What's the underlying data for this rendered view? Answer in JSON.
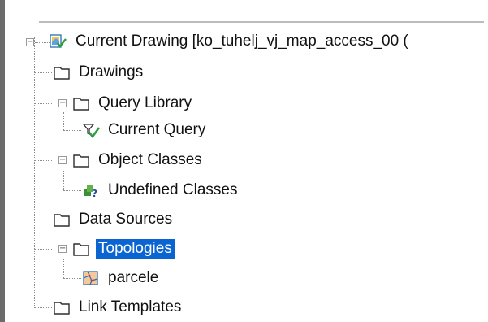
{
  "tree": {
    "root": {
      "label": "Current Drawing [ko_tuhelj_vj_map_access_00 (",
      "icon": "drawing-map-icon",
      "expanded": true
    },
    "items": [
      {
        "label": "Drawings",
        "icon": "folder-icon"
      },
      {
        "label": "Query Library",
        "icon": "folder-icon",
        "expanded": true
      },
      {
        "label": "Current Query",
        "icon": "query-filter-check-icon"
      },
      {
        "label": "Object Classes",
        "icon": "folder-icon",
        "expanded": true
      },
      {
        "label": "Undefined Classes",
        "icon": "undefined-class-icon"
      },
      {
        "label": "Data Sources",
        "icon": "folder-icon"
      },
      {
        "label": "Topologies",
        "icon": "folder-icon",
        "expanded": true,
        "selected": true
      },
      {
        "label": "parcele",
        "icon": "topology-polygon-icon"
      },
      {
        "label": "Link Templates",
        "icon": "folder-icon"
      }
    ],
    "colors": {
      "selection": "#0a64d2",
      "folder_stroke": "#2e2e2e"
    }
  }
}
